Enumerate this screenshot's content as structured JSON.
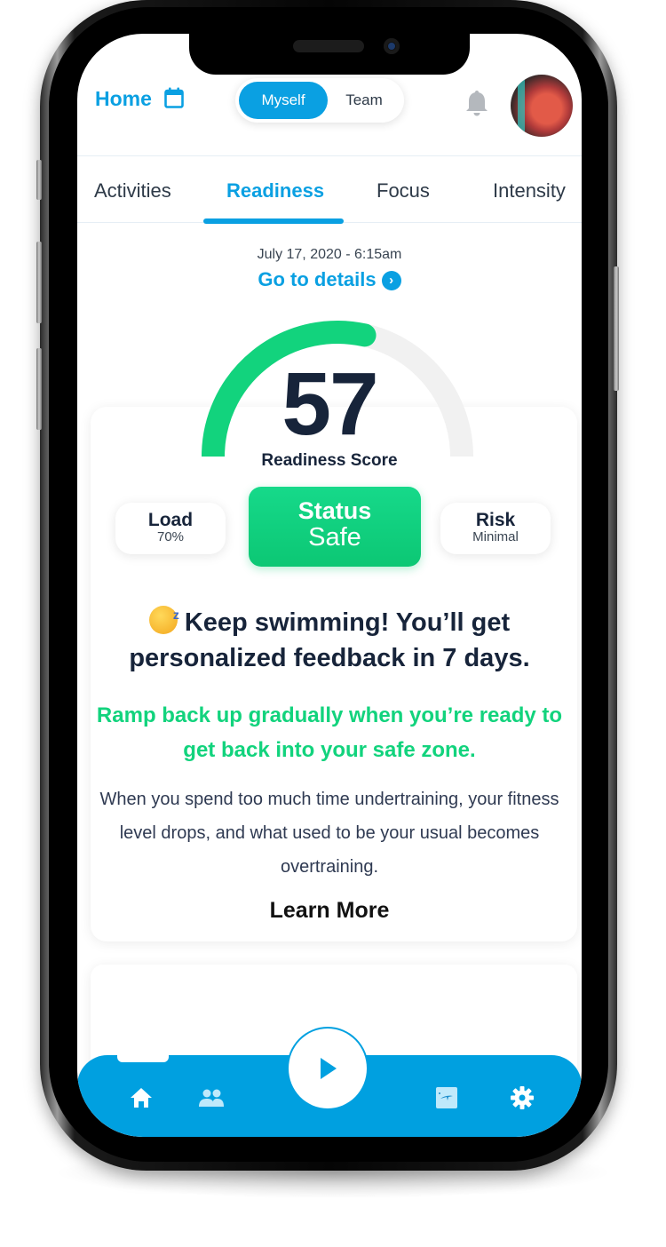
{
  "header": {
    "home_label": "Home",
    "calendar_icon": "calendar-icon",
    "segmented": {
      "options": [
        "Myself",
        "Team"
      ],
      "selected": "Myself"
    },
    "notification_icon": "bell-icon",
    "avatar_alt": "user-avatar"
  },
  "tabs": {
    "items": [
      {
        "label": "Activities"
      },
      {
        "label": "Readiness"
      },
      {
        "label": "Focus"
      },
      {
        "label": "Intensity"
      }
    ],
    "active": "Readiness"
  },
  "readiness": {
    "date": "July 17, 2020 - 6:15am",
    "details_link": "Go to details",
    "score": "57",
    "score_value": 57,
    "score_max": 100,
    "score_label": "Readiness Score",
    "gauge_color": "#12d37d",
    "gauge_track_color": "#f1f1f1"
  },
  "metrics": {
    "load": {
      "title": "Load",
      "value": "70%"
    },
    "status": {
      "title": "Status",
      "value": "Safe"
    },
    "risk": {
      "title": "Risk",
      "value": "Minimal"
    }
  },
  "message": {
    "headline": "Keep swimming! You’ll get personalized feedback in 7 days.",
    "headline_emoji": "sleeping-face-emoji",
    "advice": "Ramp back up gradually when you’re ready to get back into your safe zone.",
    "body": "When you spend too much time undertraining, your fitness level drops, and what used to be your usual becomes overtraining.",
    "learn_more": "Learn More"
  },
  "bottom_nav": {
    "items": [
      "home-icon",
      "team-icon",
      "play-icon",
      "workout-card-icon",
      "settings-gear-icon"
    ],
    "color": "#00a0e0"
  }
}
